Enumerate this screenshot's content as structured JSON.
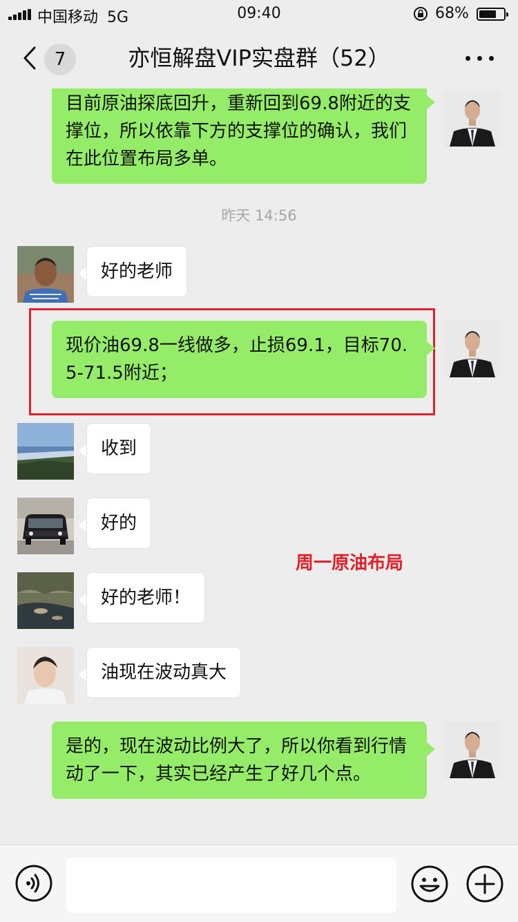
{
  "status_bar": {
    "carrier": "中国移动",
    "network": "5G",
    "time": "09:40",
    "battery_text": "68%",
    "battery_level": 0.68
  },
  "nav": {
    "unread_count": "7",
    "title": "亦恒解盘VIP实盘群（52）"
  },
  "messages": [
    {
      "side": "out",
      "text": "目前原油探底回升，重新回到69.8附近的支撑位，所以依靠下方的支撑位的确认，我们在此位置布局多单。"
    },
    {
      "time": "昨天 14:56"
    },
    {
      "side": "in",
      "avatar": "farmer-avatar",
      "text": "好的老师"
    },
    {
      "side": "out",
      "text": "现价油69.8一线做多，止损69.1，目标70.5-71.5附近；"
    },
    {
      "side": "in",
      "avatar": "landscape-avatar",
      "text": "收到"
    },
    {
      "side": "in",
      "avatar": "car-avatar",
      "text": "好的"
    },
    {
      "side": "in",
      "avatar": "stream-avatar",
      "text": "好的老师！"
    },
    {
      "side": "in",
      "avatar": "young-man-avatar",
      "text": "油现在波动真大"
    },
    {
      "side": "out",
      "text": "是的，现在波动比例大了，所以你看到行情动了一下，其实已经产生了好几个点。"
    }
  ],
  "annotation": "周一原油布局",
  "colors": {
    "background": "#ededed",
    "outgoing_bubble": "#95ec69",
    "incoming_bubble": "#ffffff",
    "highlight": "#e0202a"
  },
  "icons": [
    "signal-icon",
    "lock-rotation-icon",
    "battery-icon",
    "back-chevron-icon",
    "more-icon",
    "voice-icon",
    "emoji-icon",
    "plus-icon"
  ]
}
